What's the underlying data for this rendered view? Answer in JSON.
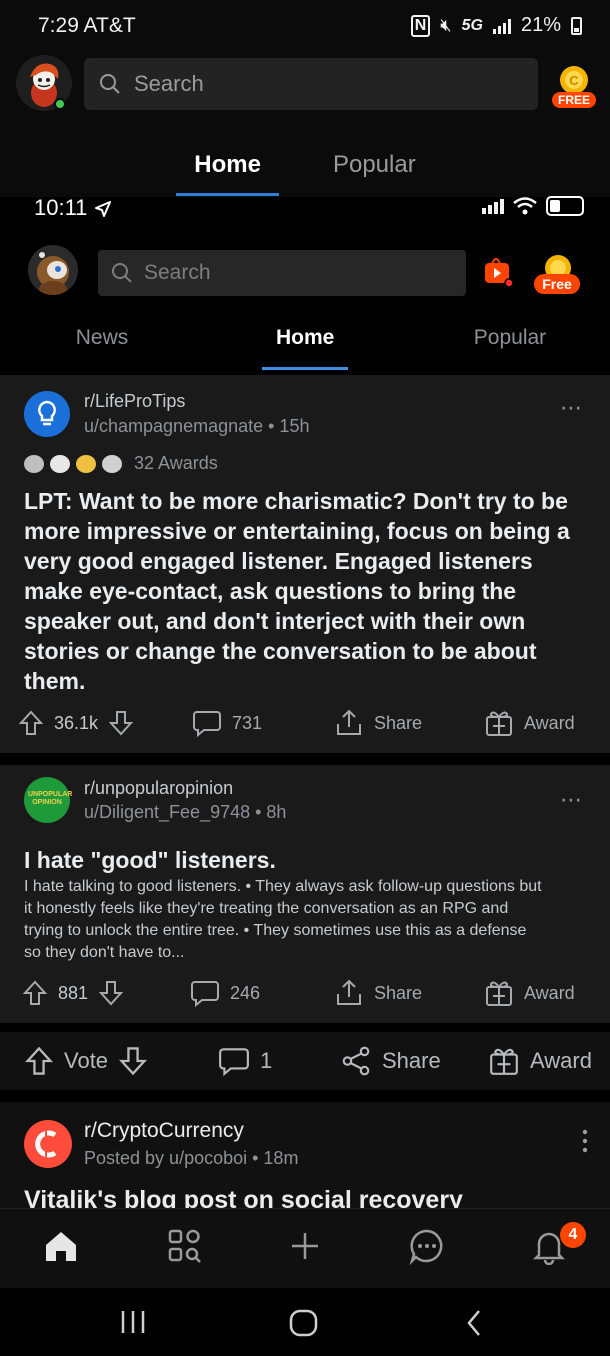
{
  "outer_status": {
    "time_carrier": "7:29 AT&T",
    "net": "5G",
    "battery": "21%"
  },
  "outer_header": {
    "search_placeholder": "Search",
    "coin_label": "FREE",
    "tabs": [
      {
        "label": "Home",
        "active": true
      },
      {
        "label": "Popular",
        "active": false
      }
    ]
  },
  "inner_status": {
    "time": "10:11"
  },
  "inner_header": {
    "search_placeholder": "Search",
    "coin_label": "Free",
    "tabs": [
      {
        "label": "News",
        "active": false
      },
      {
        "label": "Home",
        "active": true
      },
      {
        "label": "Popular",
        "active": false
      }
    ]
  },
  "posts": [
    {
      "subreddit": "r/LifeProTips",
      "meta": "u/champagnemagnate • 15h",
      "awards": "32 Awards",
      "title": "LPT: Want to be more charismatic? Don't try to be more impressive or entertaining, focus on being a very good engaged listener. Engaged listeners make eye-contact, ask questions to bring the speaker out, and don't interject with their own stories or change the conversation to be about them.",
      "votes": "36.1k",
      "comments": "731",
      "share": "Share",
      "award": "Award"
    },
    {
      "subreddit": "r/unpopularopinion",
      "meta": "u/Diligent_Fee_9748 • 8h",
      "icon_text": "UNPOPULAR OPINION",
      "title": "I hate \"good\" listeners.",
      "body": "I hate talking to good listeners. • They always ask follow-up questions but it honestly feels like they're treating the conversation as an RPG and trying to unlock the entire tree. • They sometimes use this as a defense so they don't have to...",
      "votes": "881",
      "comments": "246",
      "share": "Share",
      "award": "Award"
    }
  ],
  "vote_bar": {
    "vote": "Vote",
    "comments": "1",
    "share": "Share",
    "award": "Award"
  },
  "crypto_post": {
    "subreddit": "r/CryptoCurrency",
    "meta": "Posted by u/pocoboi • 18m",
    "title": "Vitalik's blog post on social recovery"
  },
  "bottom_nav": {
    "items": [
      "home-icon",
      "communities-icon",
      "create-icon",
      "chat-icon",
      "notifications-icon"
    ],
    "notification_count": "4"
  },
  "colors": {
    "accent_blue": "#2f7fd6",
    "orange": "#ff4500",
    "card_bg": "#1a1a1b"
  }
}
